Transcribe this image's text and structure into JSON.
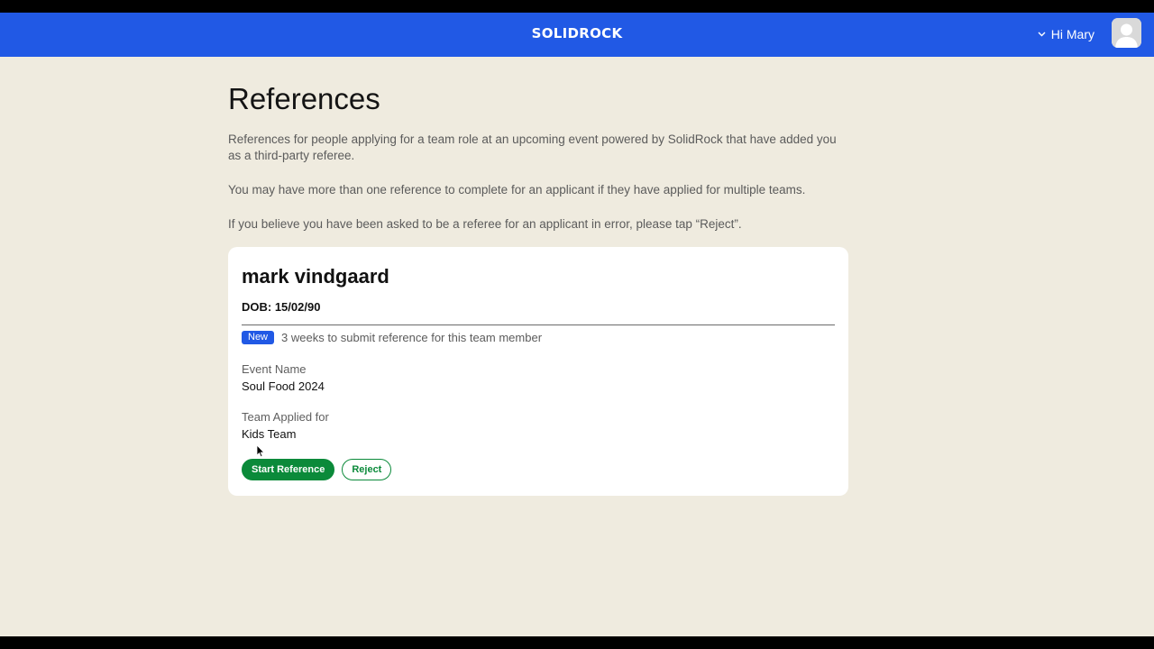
{
  "header": {
    "brand": "SOLIDROCK",
    "greeting": "Hi Mary",
    "brand_color": "#2159e5"
  },
  "page": {
    "title": "References",
    "intro": [
      "References for people applying for a team role at an upcoming event powered by SolidRock that have added you as a third-party referee.",
      "You may have more than one reference to complete for an applicant if they have applied for multiple teams.",
      "If you believe you have been asked to be a referee for an applicant in error, please tap “Reject”."
    ],
    "background_color": "#efebdf"
  },
  "reference_card": {
    "name": "mark vindgaard",
    "dob": "DOB: 15/02/90",
    "badge": "New",
    "deadline": "3 weeks to submit reference for this team member",
    "event_label": "Event Name",
    "event_value": "Soul Food 2024",
    "team_label": "Team Applied for",
    "team_value": "Kids Team",
    "start_button": "Start Reference",
    "reject_button": "Reject",
    "action_color": "#0b8a3a"
  },
  "icons": {
    "menu_chevron": "chevron-down-icon",
    "avatar": "user-avatar-icon",
    "pointer": "mouse-cursor-icon"
  }
}
